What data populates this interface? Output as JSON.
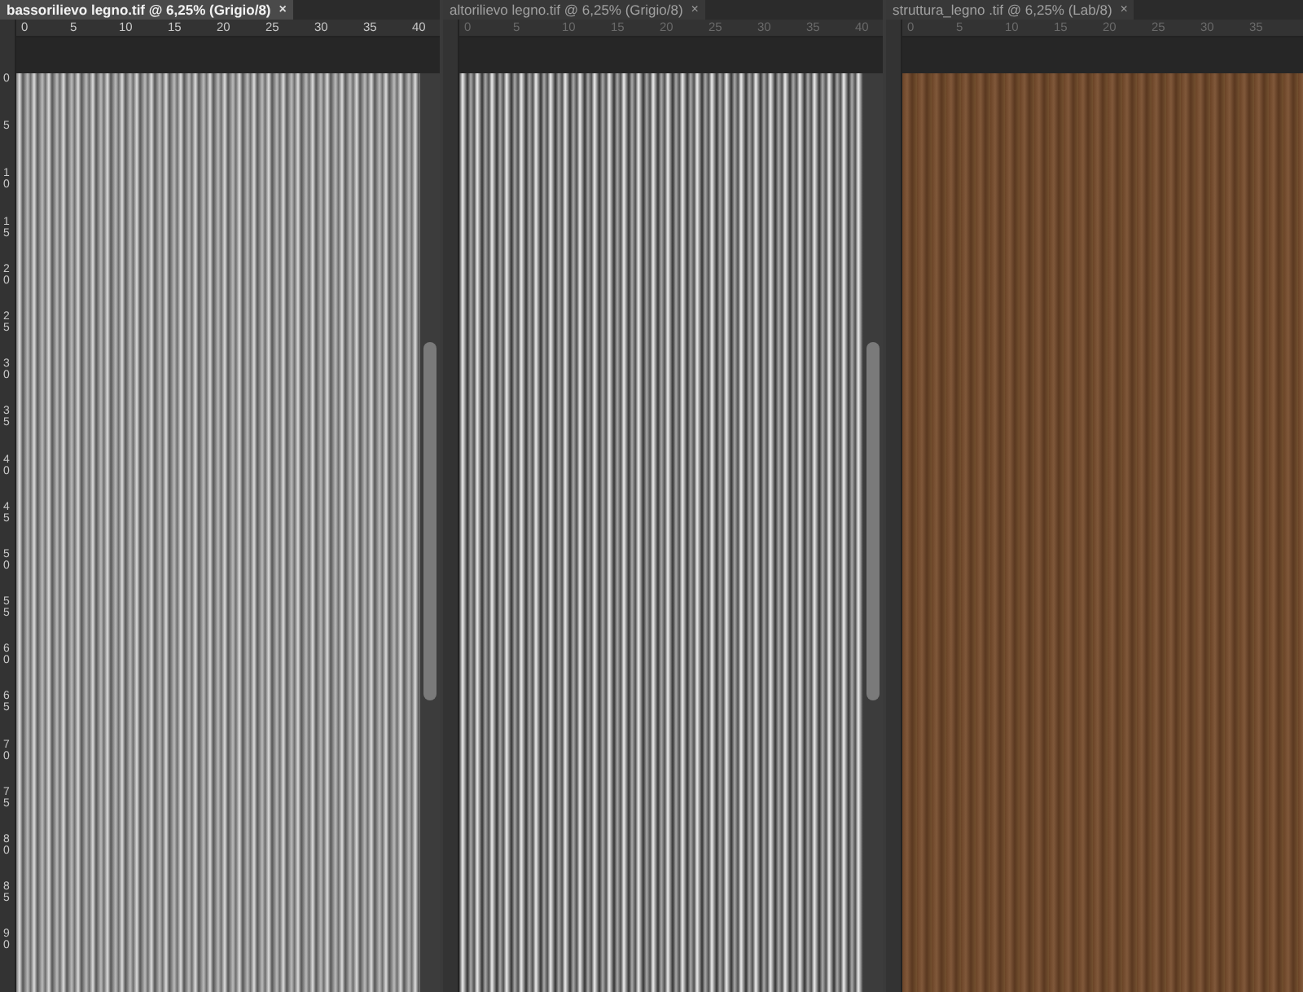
{
  "documents": [
    {
      "tab": {
        "title": "bassorilievo legno.tif @ 6,25% (Grigio/8)",
        "close": "×",
        "selected": true
      },
      "ruler_h": [
        "0",
        "5",
        "10",
        "15",
        "20",
        "25",
        "30",
        "35",
        "40"
      ],
      "ruler_v": [
        "0",
        "5",
        "10",
        "15",
        "20",
        "25",
        "30",
        "35",
        "40",
        "45",
        "50",
        "55",
        "60",
        "65",
        "70",
        "75",
        "80",
        "85",
        "90"
      ],
      "image": {
        "kind": "relief"
      },
      "scrollbar": true
    },
    {
      "tab": {
        "title": "altorilievo legno.tif @ 6,25% (Grigio/8)",
        "close": "×",
        "selected": false
      },
      "ruler_h": [
        "0",
        "5",
        "10",
        "15",
        "20",
        "25",
        "30",
        "35",
        "40"
      ],
      "image": {
        "kind": "relief-high"
      },
      "scrollbar": true
    },
    {
      "tab": {
        "title": "struttura_legno .tif @ 6,25% (Lab/8)",
        "close": "×",
        "selected": false
      },
      "ruler_h": [
        "0",
        "5",
        "10",
        "15",
        "20",
        "25",
        "30",
        "35"
      ],
      "image": {
        "kind": "wood"
      },
      "scrollbar": false
    }
  ]
}
